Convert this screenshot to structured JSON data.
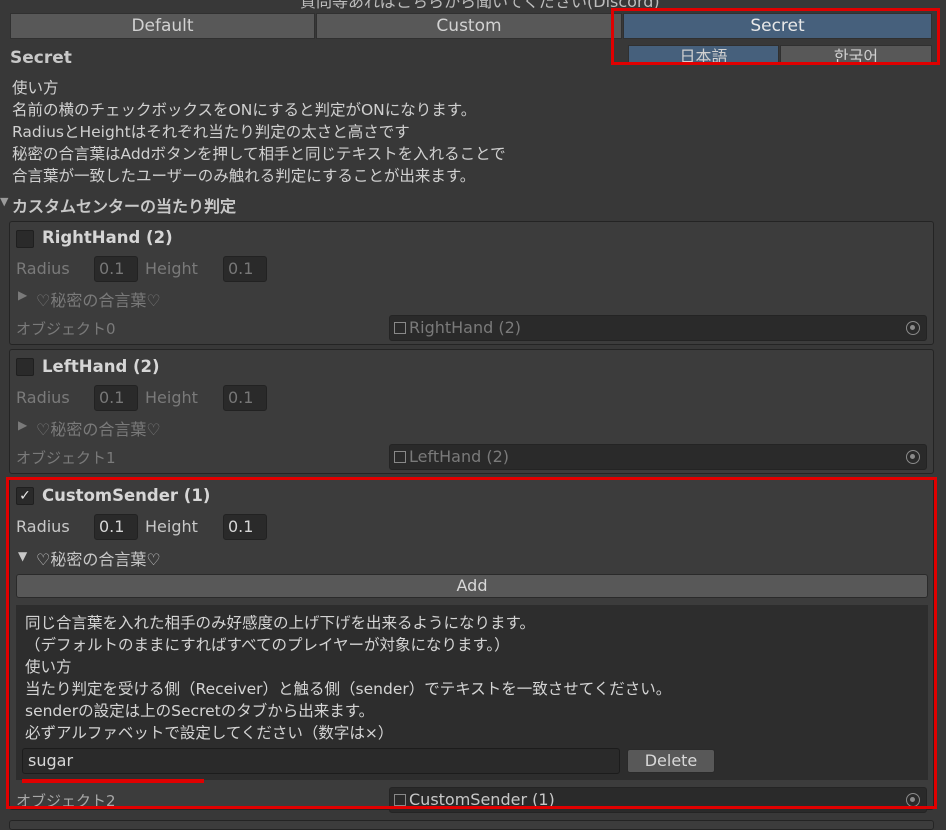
{
  "top_note": "質問等あればこちらから聞いてください(Discord)",
  "tabs": [
    {
      "label": "Default",
      "active": false
    },
    {
      "label": "Custom",
      "active": false
    },
    {
      "label": "Secret",
      "active": true
    }
  ],
  "languages": [
    {
      "label": "日本語",
      "active": true
    },
    {
      "label": "한국어",
      "active": false
    }
  ],
  "section": {
    "title": "Secret",
    "description": [
      "使い方",
      "名前の横のチェックボックスをONにすると判定がONになります。",
      "RadiusとHeightはそれぞれ当たり判定の太さと高さです",
      "秘密の合言葉はAddボタンを押して相手と同じテキストを入れることで",
      "合言葉が一致したユーザーのみ触れる判定にすることが出来ます。"
    ]
  },
  "custom_center": {
    "header": "カスタムセンターの当たり判定",
    "radius_label": "Radius",
    "height_label": "Height",
    "secret_fold_label": "♡秘密の合言葉♡",
    "items": [
      {
        "name": "RightHand (2)",
        "enabled": false,
        "radius": "0.1",
        "height": "0.1",
        "object_label": "オブジェクト0",
        "object_value": "RightHand (2)"
      },
      {
        "name": "LeftHand (2)",
        "enabled": false,
        "radius": "0.1",
        "height": "0.1",
        "object_label": "オブジェクト1",
        "object_value": "LeftHand (2)"
      },
      {
        "name": "CustomSender (1)",
        "enabled": true,
        "radius": "0.1",
        "height": "0.1",
        "object_label": "オブジェクト2",
        "object_value": "CustomSender (1)"
      }
    ]
  },
  "secret_panel": {
    "add_label": "Add",
    "info": [
      "同じ合言葉を入れた相手のみ好感度の上げ下げを出来るようになります。",
      "（デフォルトのままにすればすべてのプレイヤーが対象になります。）",
      "使い方",
      "当たり判定を受ける側（Receiver）と触る側（sender）でテキストを一致させてください。",
      "senderの設定は上のSecretのタブから出来ます。",
      "必ずアルファベットで設定してください（数字は×）"
    ],
    "entry_value": "sugar",
    "delete_label": "Delete"
  },
  "colors": {
    "background": "#383838",
    "active_tab": "#46607c",
    "highlight": "#e00000"
  }
}
